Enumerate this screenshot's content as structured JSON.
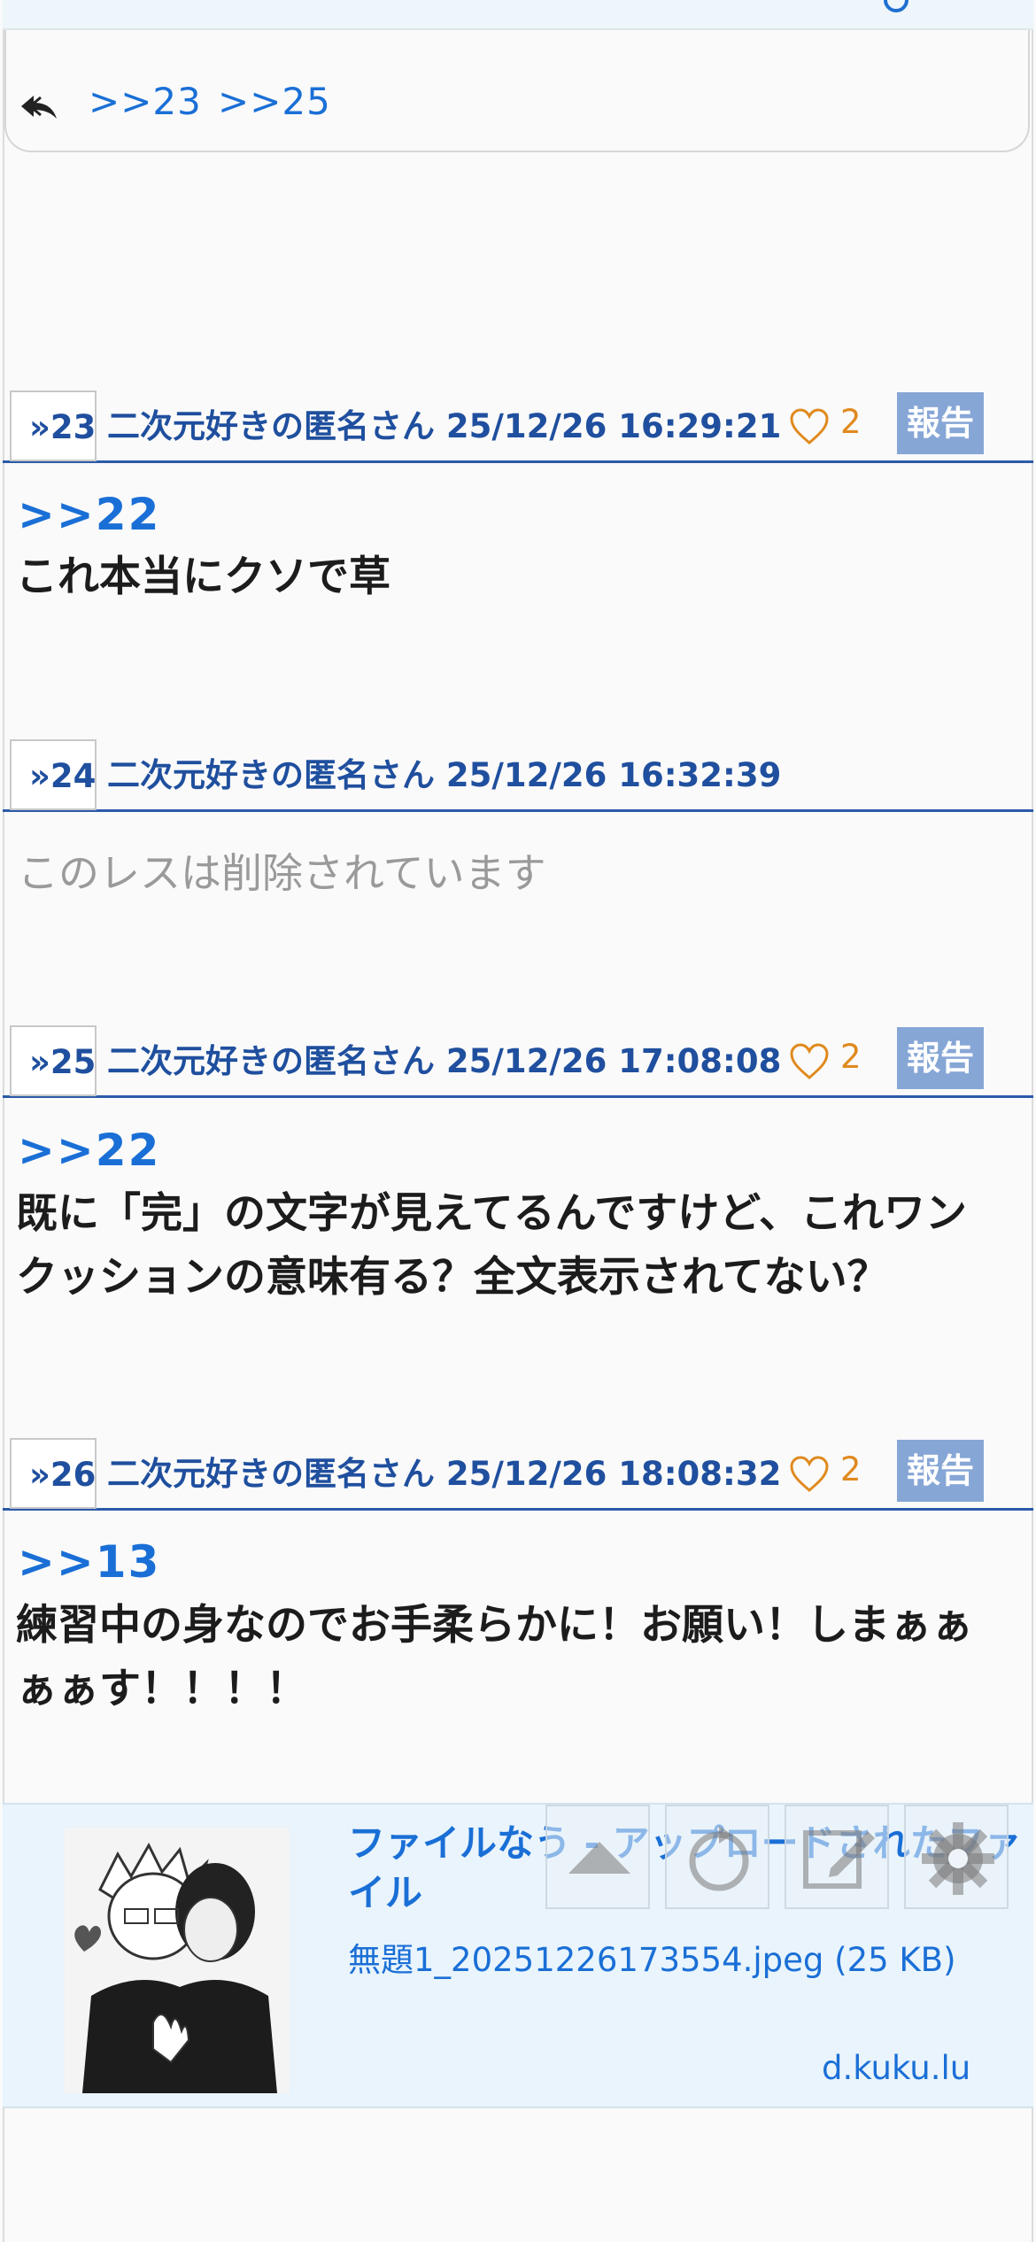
{
  "reply_links": {
    "link_1": ">>23",
    "link_2": ">>25"
  },
  "posts": [
    {
      "number": "23",
      "meta": "二次元好きの匿名さん 25/12/26 16:29:21",
      "likes": "2",
      "report_label": "報告",
      "ref": ">>22",
      "text": "これ本当にクソで草"
    },
    {
      "number": "24",
      "meta": "二次元好きの匿名さん 25/12/26 16:32:39",
      "deleted_text": "このレスは削除されています"
    },
    {
      "number": "25",
      "meta": "二次元好きの匿名さん 25/12/26 17:08:08",
      "likes": "2",
      "report_label": "報告",
      "ref": ">>22",
      "text_line1": "既に「完」の文字が見えてるんですけど、これワン",
      "text_line2": "クッションの意味有る？全文表示されてない？"
    },
    {
      "number": "26",
      "meta": "二次元好きの匿名さん 25/12/26 18:08:32",
      "likes": "2",
      "report_label": "報告",
      "ref": ">>13",
      "text_line1": "練習中の身なのでお手柔らかに！お願い！しまぁぁ",
      "text_line2": "ぁぁす！！！！"
    }
  ],
  "ad": {
    "title": "ファイルなう - アップロードされたファイル",
    "file": "無題1_20251226173554.jpeg (25 KB)",
    "domain": "d.kuku.lu"
  },
  "colors": {
    "link_blue": "#1a6fd6",
    "meta_blue": "#1f4f9e",
    "report_bg": "#86a6d6",
    "like_orange": "#e08a1e"
  },
  "icons": [
    "reply-icon",
    "heart-icon",
    "scroll-top-icon",
    "refresh-icon",
    "edit-icon",
    "gear-icon"
  ]
}
